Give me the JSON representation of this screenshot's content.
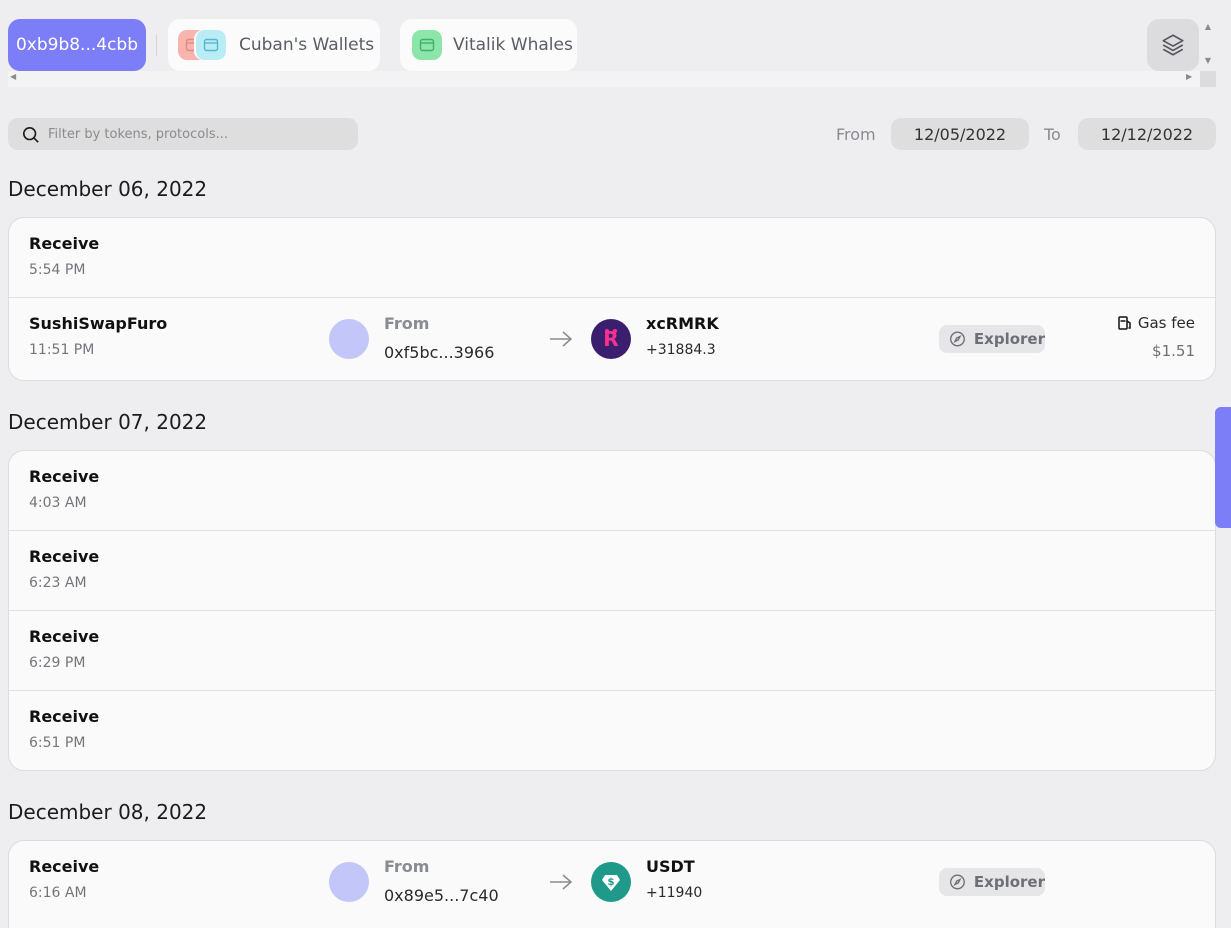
{
  "tabs": {
    "active_label": "0xb9b8...4cbb",
    "cuban_label": "Cuban's Wallets",
    "vitalik_label": "Vitalik Whales"
  },
  "colors": {
    "accent": "#7b7ef6",
    "background": "#eeeef0",
    "card": "#fafafa"
  },
  "filter": {
    "search_placeholder": "Filter by tokens, protocols...",
    "from_label": "From",
    "from_date": "12/05/2022",
    "to_label": "To",
    "to_date": "12/12/2022"
  },
  "days": [
    {
      "title": "December 06, 2022",
      "rows": [
        {
          "title": "Receive",
          "time": "5:54 PM"
        },
        {
          "title": "SushiSwapFuro",
          "time": "11:51 PM",
          "from_label": "From",
          "from_addr": "0xf5bc...3966",
          "token": "xcRMRK",
          "amount": "+31884.3",
          "explorer": "Explorer",
          "gas_label": "Gas fee",
          "gas_value": "$1.51"
        }
      ]
    },
    {
      "title": "December 07, 2022",
      "rows": [
        {
          "title": "Receive",
          "time": "4:03 AM"
        },
        {
          "title": "Receive",
          "time": "6:23 AM"
        },
        {
          "title": "Receive",
          "time": "6:29 PM"
        },
        {
          "title": "Receive",
          "time": "6:51 PM"
        }
      ]
    },
    {
      "title": "December 08, 2022",
      "rows": [
        {
          "title": "Receive",
          "time": "6:16 AM",
          "from_label": "From",
          "from_addr": "0x89e5...7c40",
          "token": "USDT",
          "amount": "+11940",
          "explorer": "Explorer"
        }
      ]
    }
  ],
  "icons": [
    "search-icon",
    "wallet-icon",
    "layers-icon",
    "arrow-right-icon",
    "compass-icon",
    "gas-pump-icon"
  ]
}
